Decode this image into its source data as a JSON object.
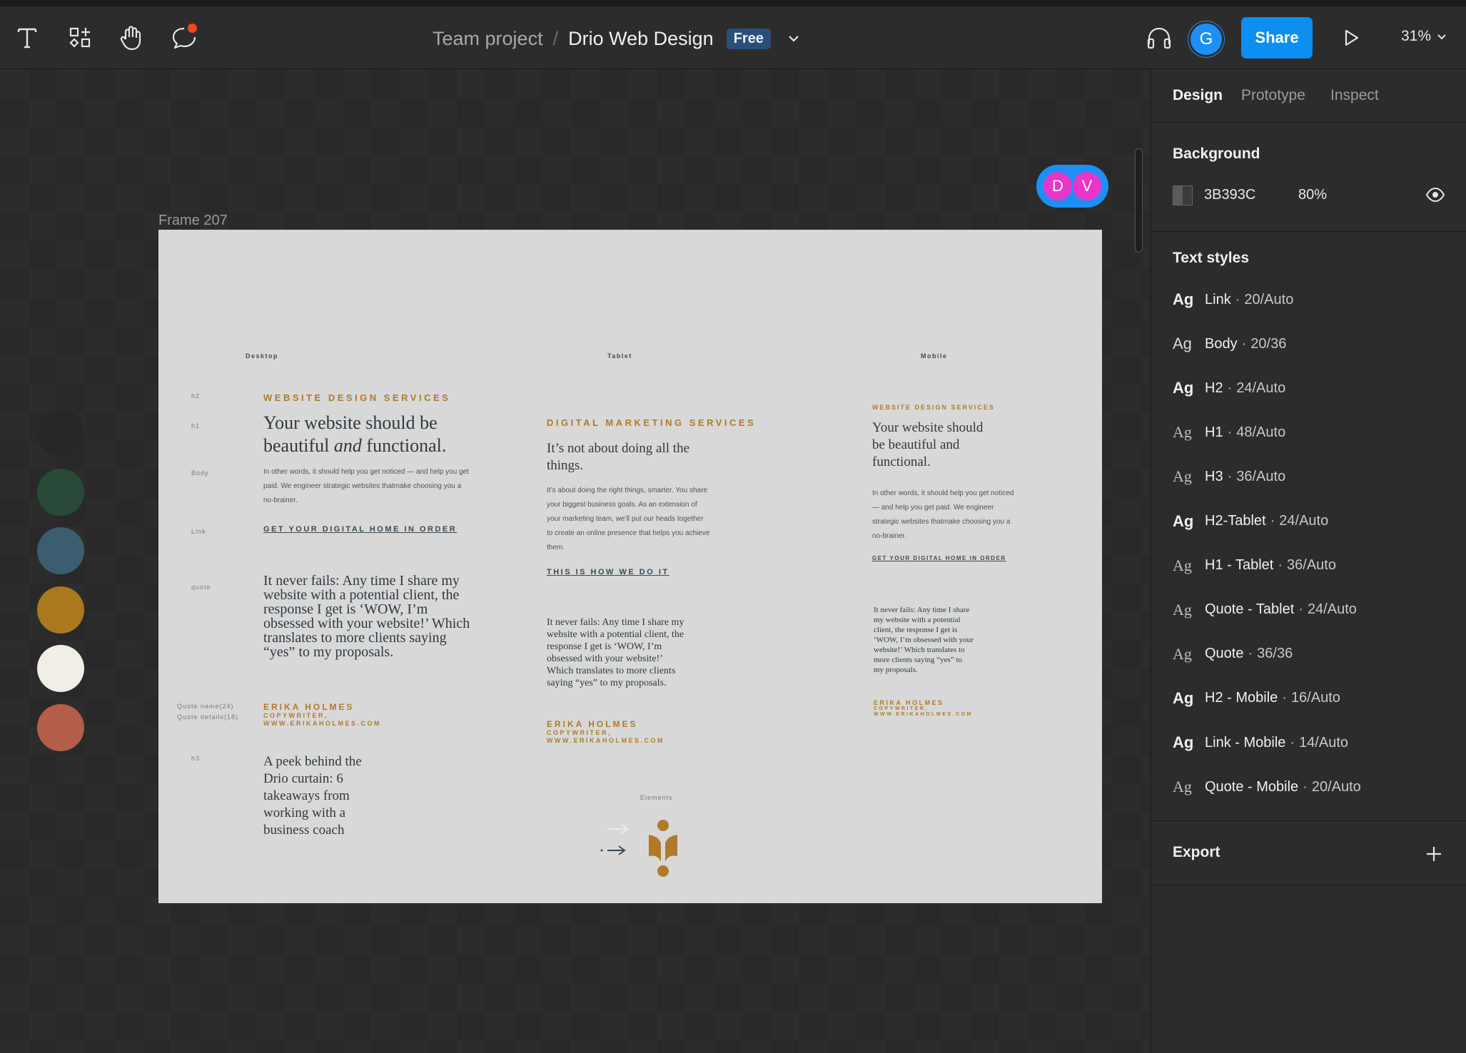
{
  "toolbar": {
    "breadcrumb_team": "Team project",
    "breadcrumb_sep": "/",
    "file_name": "Drio Web Design",
    "plan_badge": "Free",
    "avatar_initial": "G",
    "share_label": "Share",
    "zoom": "31%"
  },
  "canvas": {
    "frame_label": "Frame 207",
    "collaborators": [
      "D",
      "V"
    ],
    "swatches": [
      "#262827",
      "#2a4a39",
      "#3c5d70",
      "#a9781f",
      "#f1eee8",
      "#b35e4a"
    ]
  },
  "frame": {
    "col_labels": {
      "desktop": "Desktop",
      "tablet": "Tablet",
      "mobile": "Mobile"
    },
    "spec_labels": {
      "h2": "h2",
      "h1": "h1",
      "body": "Body",
      "link": "Link",
      "quote": "quote",
      "quote_name": "Quote name(24)",
      "quote_details": "Quote details(18)",
      "h3": "h3"
    },
    "desktop": {
      "h2": "WEBSITE DESIGN SERVICES",
      "h1_pre": "Your website should be beautiful ",
      "h1_em": "and",
      "h1_post": " functional.",
      "body": "In other words, it should help you get noticed — and help you get paid. We engineer strategic websites thatmake choosing you a no-brainer.",
      "link": "GET YOUR DIGITAL HOME IN ORDER",
      "quote": "It never fails: Any time I share my website with a potential client, the response I get is ‘WOW, I’m obsessed with your website!’ Which translates to more clients saying “yes” to my proposals.",
      "author_name": "ERIKA HOLMES",
      "author_role": "COPYWRITER,",
      "author_site": "WWW.ERIKAHOLMES.COM",
      "h3": "A peek behind the Drio curtain: 6 takeaways from working with a business coach"
    },
    "tablet": {
      "h2": "DIGITAL MARKETING SERVICES",
      "h1": "It’s not about doing all the things.",
      "body": "It’s about doing the right things, smarter. You share your biggest business goals. As an extension of your marketing team, we’ll put our heads together to create an online presence that helps you achieve them.",
      "link": "THIS IS HOW WE DO IT",
      "quote": "It never fails: Any time I share my website with a potential client, the response I get is ‘WOW, I’m obsessed with your website!’ Which translates to more clients saying “yes” to my proposals.",
      "author_name": "ERIKA HOLMES",
      "author_role": "COPYWRITER,",
      "author_site": "WWW.ERIKAHOLMES.COM",
      "elements_label": "Elements"
    },
    "mobile": {
      "h2": "WEBSITE DESIGN SERVICES",
      "h1": "Your website should be beautiful and functional.",
      "body": "In other words, it should help you get noticed — and help you get paid. We engineer strategic websites thatmake choosing you a no-brainer.",
      "link": "GET YOUR DIGITAL HOME IN ORDER",
      "quote": "It never fails: Any time I share my website with a potential client, the response I get is ‘WOW, I’m obsessed with your website!’ Which translates to more clients saying “yes” to my proposals.",
      "author_name": "ERIKA HOLMES",
      "author_role": "COPYWRITER,",
      "author_site": "WWW.ERIKAHOLMES.COM"
    }
  },
  "panel": {
    "tabs": [
      "Design",
      "Prototype",
      "Inspect"
    ],
    "background": {
      "title": "Background",
      "hex": "3B393C",
      "opacity": "80%"
    },
    "text_styles": {
      "title": "Text styles",
      "items": [
        {
          "ag": "Ag",
          "name": "Link",
          "meta": "20/Auto",
          "weight": "bold"
        },
        {
          "ag": "Ag",
          "name": "Body",
          "meta": "20/36",
          "weight": "regular"
        },
        {
          "ag": "Ag",
          "name": "H2",
          "meta": "24/Auto",
          "weight": "bold"
        },
        {
          "ag": "Ag",
          "name": "H1",
          "meta": "48/Auto",
          "weight": "light"
        },
        {
          "ag": "Ag",
          "name": "H3",
          "meta": "36/Auto",
          "weight": "light"
        },
        {
          "ag": "Ag",
          "name": "H2-Tablet",
          "meta": "24/Auto",
          "weight": "bold"
        },
        {
          "ag": "Ag",
          "name": "H1 - Tablet",
          "meta": "36/Auto",
          "weight": "light"
        },
        {
          "ag": "Ag",
          "name": "Quote - Tablet",
          "meta": "24/Auto",
          "weight": "light"
        },
        {
          "ag": "Ag",
          "name": "Quote",
          "meta": "36/36",
          "weight": "light"
        },
        {
          "ag": "Ag",
          "name": "H2 - Mobile",
          "meta": "16/Auto",
          "weight": "bold"
        },
        {
          "ag": "Ag",
          "name": "Link - Mobile",
          "meta": "14/Auto",
          "weight": "bold"
        },
        {
          "ag": "Ag",
          "name": "Quote - Mobile",
          "meta": "20/Auto",
          "weight": "light"
        }
      ]
    },
    "export": {
      "title": "Export"
    },
    "icons": [
      "text-tool-icon",
      "components-icon",
      "hand-tool-icon",
      "comment-icon",
      "chevron-down-icon",
      "headphones-icon",
      "play-icon",
      "eye-icon",
      "plus-icon"
    ]
  }
}
